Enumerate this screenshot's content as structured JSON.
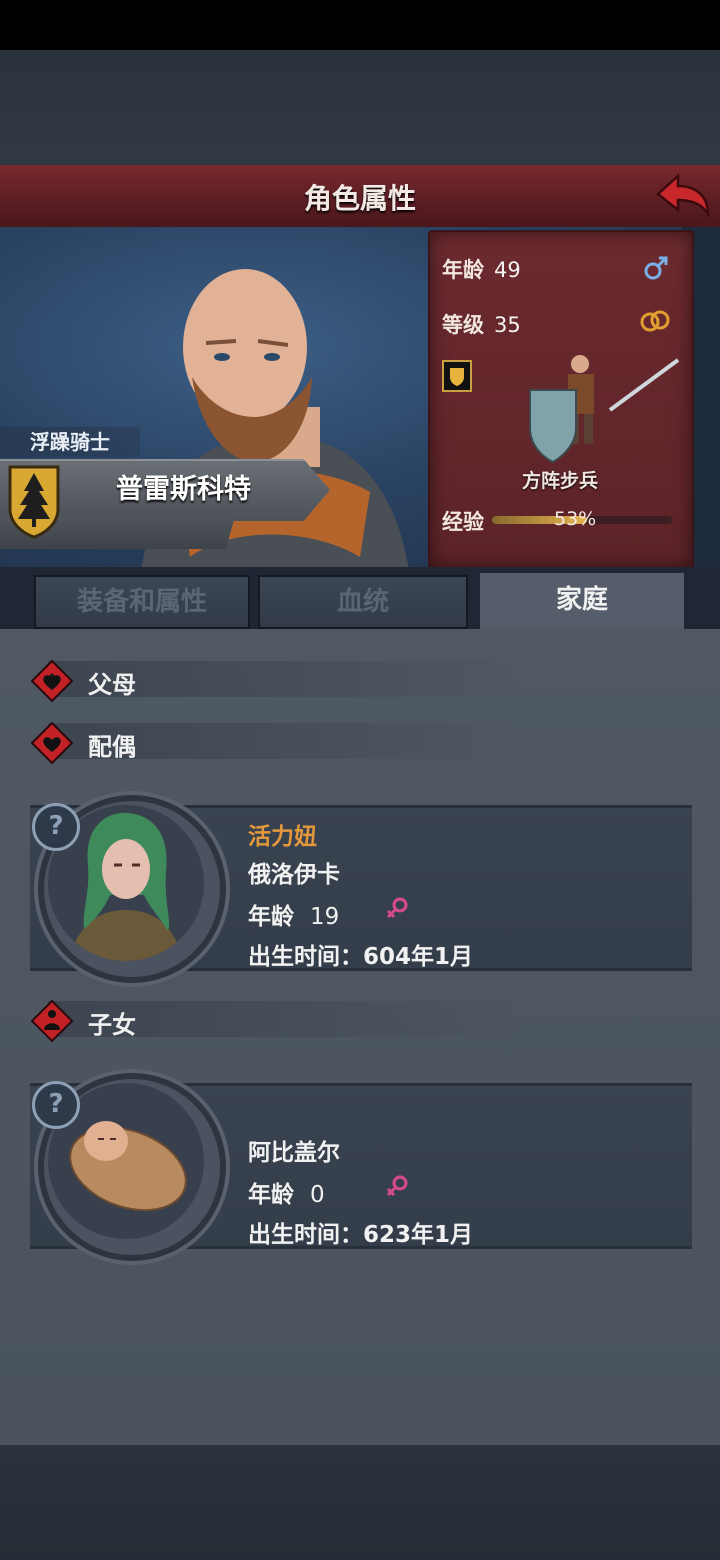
{
  "header": {
    "title": "角色属性"
  },
  "character": {
    "class_title": "浮躁骑士",
    "name": "普雷斯科特"
  },
  "stats": {
    "age_label": "年龄",
    "age_value": "49",
    "level_label": "等级",
    "level_value": "35",
    "unit_name": "方阵步兵",
    "xp_label": "经验",
    "xp_percent": "53%",
    "xp_fraction": 0.53
  },
  "tabs": [
    {
      "label": "装备和属性"
    },
    {
      "label": "血统"
    },
    {
      "label": "家庭"
    }
  ],
  "sections": {
    "parents": "父母",
    "spouse": "配偶",
    "children": "子女"
  },
  "spouse": {
    "trait": "活力妞",
    "name": "俄洛伊卡",
    "age_label": "年龄",
    "age_value": "19",
    "birth": "出生时间：604年1月"
  },
  "child": {
    "name": "阿比盖尔",
    "age_label": "年龄",
    "age_value": "0",
    "birth": "出生时间：623年1月"
  },
  "icons": {
    "back": "back-arrow-icon",
    "male": "male-symbol-icon",
    "female": "female-symbol-icon",
    "ring": "marriage-ring-icon",
    "shield": "shield-badge-icon",
    "heart": "heart-diamond-icon",
    "child": "child-diamond-icon",
    "crest": "tree-crest-icon",
    "question": "question-icon"
  },
  "colors": {
    "title_bar": "#5a1d22",
    "stats_panel": "#6b2a2f",
    "trait": "#e4983c",
    "female": "#d84a8c",
    "male": "#7ab0e8"
  }
}
